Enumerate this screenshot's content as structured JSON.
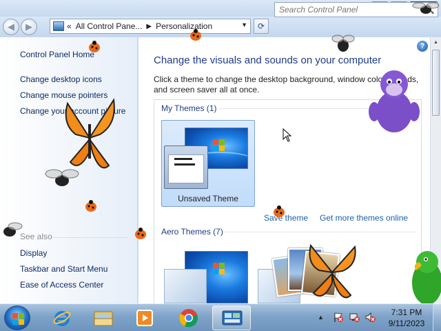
{
  "window": {
    "minimize_glyph": "▬",
    "maximize_glyph": "❐",
    "close_glyph": "✕"
  },
  "navigation": {
    "back_glyph": "◀",
    "forward_glyph": "▶",
    "breadcrumb_lead": "«",
    "breadcrumb_sep": "▶",
    "breadcrumb_root": "All Control Pane...",
    "breadcrumb_current": "Personalization",
    "address_drop_glyph": "▼",
    "refresh_glyph": "⟳",
    "search_placeholder": "Search Control Panel"
  },
  "sidebar": {
    "home_link": "Control Panel Home",
    "links": [
      "Change desktop icons",
      "Change mouse pointers",
      "Change your account picture"
    ],
    "see_also_label": "See also",
    "see_also_links": [
      "Display",
      "Taskbar and Start Menu",
      "Ease of Access Center"
    ]
  },
  "main": {
    "help_glyph": "?",
    "title": "Change the visuals and sounds on your computer",
    "description": "Click a theme to change the desktop background, window color, sounds, and screen saver all at once.",
    "my_themes_heading": "My Themes (1)",
    "unsaved_theme_label": "Unsaved Theme",
    "save_theme_link": "Save theme",
    "get_more_link": "Get more themes online",
    "aero_themes_heading": "Aero Themes (7)"
  },
  "taskbar": {
    "pinned": [
      "internet-explorer",
      "windows-explorer",
      "media-player",
      "chrome",
      "control-panel"
    ],
    "clock_time": "7:31 PM",
    "clock_date": "9/11/2023",
    "tray_up_glyph": "▲"
  },
  "colors": {
    "link_blue": "#1d5fb0",
    "heading_blue": "#1d3c87",
    "taskbar": "#7fa3c8"
  }
}
